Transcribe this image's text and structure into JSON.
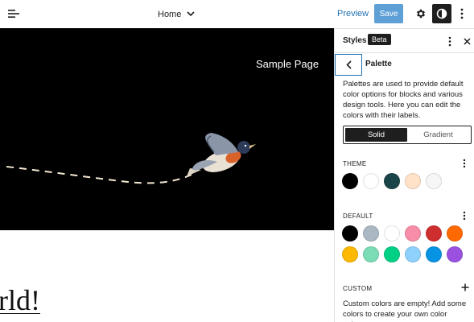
{
  "topbar": {
    "document_title": "Home",
    "preview_label": "Preview",
    "save_label": "Save"
  },
  "canvas": {
    "site_nav_item": "Sample Page",
    "heading_fragment": "rld!"
  },
  "sidebar": {
    "title": "Styles",
    "badge": "Beta",
    "panel_title": "Palette",
    "description": "Palettes are used to provide default color options for blocks and various design tools. Here you can edit the colors with their labels.",
    "tabs": [
      {
        "label": "Solid",
        "active": true
      },
      {
        "label": "Gradient",
        "active": false
      }
    ],
    "theme": {
      "label": "THEME",
      "colors": [
        "#000000",
        "#ffffff",
        "#1a4548",
        "#ffe2c7",
        "#f6f6f6"
      ]
    },
    "default": {
      "label": "DEFAULT",
      "colors": [
        "#000000",
        "#abb8c3",
        "#ffffff",
        "#f78da7",
        "#cf2e2e",
        "#ff6900",
        "#fcb900",
        "#7bdcb5",
        "#00d084",
        "#8ed1fc",
        "#0693e3",
        "#9b51e0"
      ]
    },
    "custom": {
      "label": "CUSTOM",
      "empty_text": "Custom colors are empty! Add some colors to create your own color palette."
    }
  },
  "icons": {
    "menu": "hamburger-icon",
    "chevron": "chevron-down-icon",
    "settings": "gear-icon",
    "styles": "contrast-icon",
    "more": "vertical-ellipsis-icon",
    "close": "close-icon",
    "back": "chevron-left-icon",
    "add": "plus-icon"
  },
  "colors": {
    "accent": "#2271b1",
    "save_bg": "#5ea0d6",
    "dark": "#1e1e1e"
  }
}
